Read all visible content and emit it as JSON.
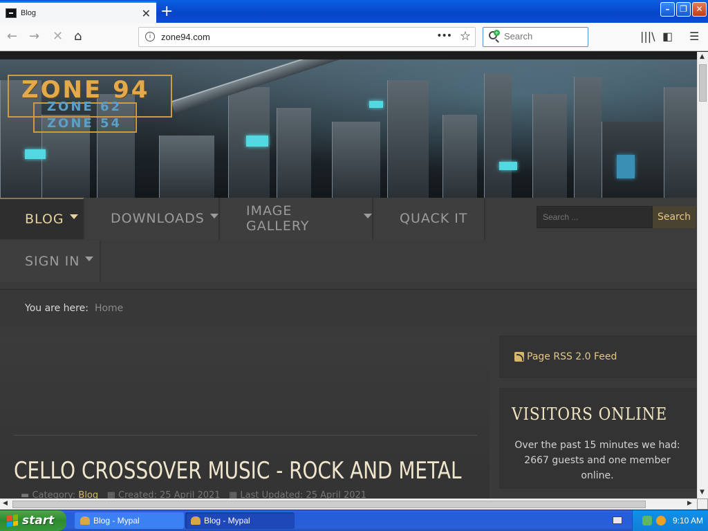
{
  "browser": {
    "tab_title": "Blog",
    "url": "zone94.com",
    "search_placeholder": "Search",
    "window_buttons": [
      "minimize",
      "restore",
      "close"
    ]
  },
  "site": {
    "logo": {
      "main": "ZONE 94",
      "sub1": "ZONE 62",
      "sub2": "ZONE 54"
    },
    "nav": [
      {
        "label": "BLOG",
        "dropdown": true,
        "active": true
      },
      {
        "label": "DOWNLOADS",
        "dropdown": true,
        "active": false
      },
      {
        "label": "IMAGE GALLERY",
        "dropdown": true,
        "active": false
      },
      {
        "label": "QUACK IT",
        "dropdown": false,
        "active": false
      },
      {
        "label": "SIGN IN",
        "dropdown": true,
        "active": false
      }
    ],
    "search": {
      "placeholder": "Search ...",
      "button": "Search"
    },
    "breadcrumb": {
      "label": "You are here:",
      "home": "Home"
    },
    "article": {
      "title": "CELLO CROSSOVER MUSIC - ROCK AND METAL",
      "category_label": "Category:",
      "category": "Blog",
      "created": "Created: 25 April 2021",
      "updated": "Last Updated: 25 April 2021"
    },
    "sidebar": {
      "rss": "Page RSS 2.0 Feed",
      "visitors_title": "VISITORS ONLINE",
      "visitors_text": "Over the past 15 minutes we had: 2667 guests and one member online."
    },
    "colors": {
      "accent": "#e2c883",
      "nav_text": "#9c9c9c",
      "background": "#3a3a3a"
    }
  },
  "taskbar": {
    "start": "start",
    "tasks": [
      "Blog - Mypal",
      "Blog - Mypal"
    ],
    "clock": "9:10 AM"
  }
}
